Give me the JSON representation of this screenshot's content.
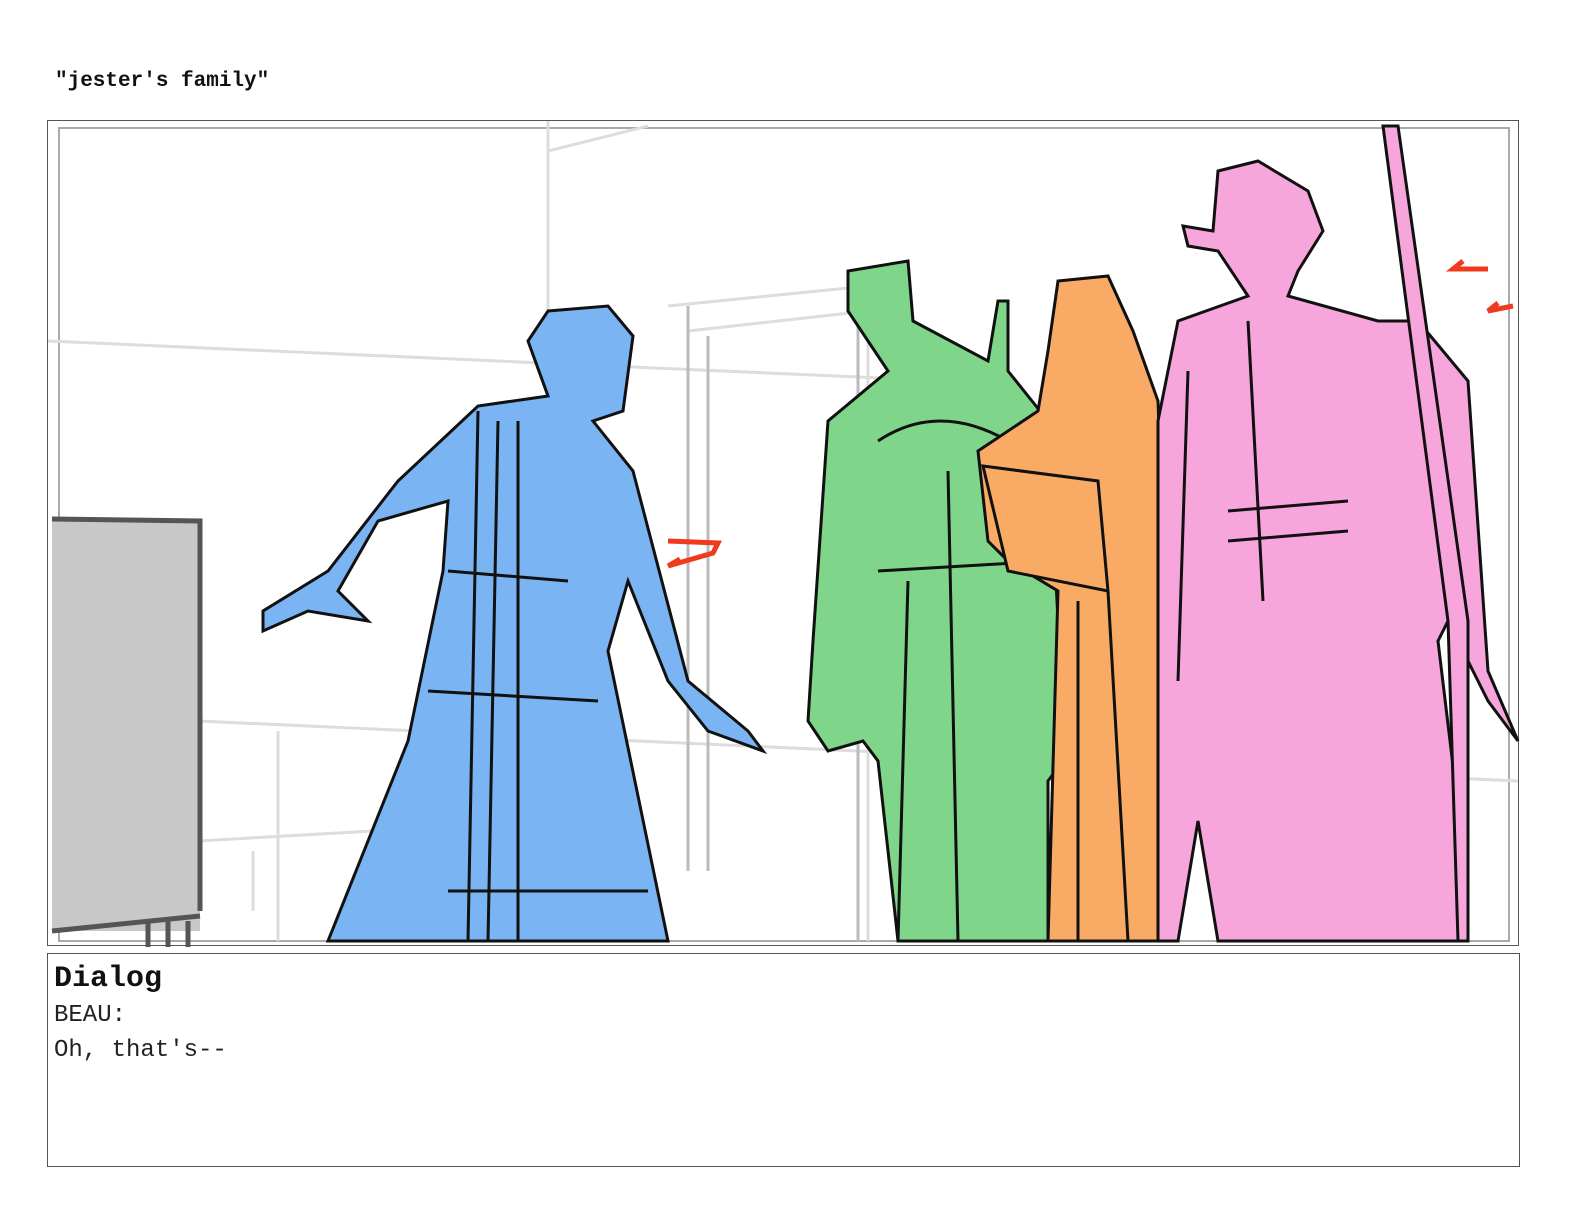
{
  "board": {
    "title": "\"jester's family\""
  },
  "panel": {
    "colors": {
      "blue": "#7ab4f2",
      "green": "#7fd68b",
      "orange": "#f9ab66",
      "pink": "#f7a6dc",
      "arrow": "#f03a1e",
      "box": "#c8c8c8"
    }
  },
  "dialog": {
    "heading": "Dialog",
    "speaker": "BEAU:",
    "line": "Oh, that's--"
  }
}
